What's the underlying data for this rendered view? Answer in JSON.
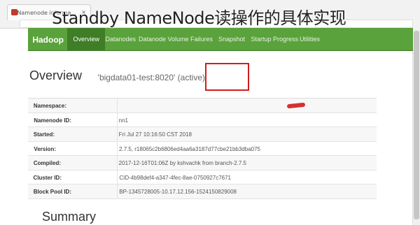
{
  "caption": "Standby NameNode读操作的具体实现",
  "browser": {
    "tab_title": "Namenode informa...",
    "tab_close": "×"
  },
  "nav": {
    "brand": "Hadoop",
    "items": [
      "Overview",
      "Datanodes",
      "Datanode Volume Failures",
      "Snapshot",
      "Startup Progress",
      "Utilities"
    ]
  },
  "overview": {
    "title": "Overview",
    "subtitle": "'bigdata01-test:8020' (active)"
  },
  "table": [
    {
      "label": "Namespace:",
      "value": ""
    },
    {
      "label": "Namenode ID:",
      "value": "nn1"
    },
    {
      "label": "Started:",
      "value": "Fri Jul 27 10:16:50 CST 2018"
    },
    {
      "label": "Version:",
      "value": "2.7.5, r18065c2b6806ed4aa6a3187d77cbe21bb3dba075"
    },
    {
      "label": "Compiled:",
      "value": "2017-12-16T01:06Z by kshvachk from branch-2.7.5"
    },
    {
      "label": "Cluster ID:",
      "value": "CID-4b98def4-a347-4fec-8ae-0750927c7671"
    },
    {
      "label": "Block Pool ID:",
      "value": "BP-1345728005-10.17.12.156-1524150829008"
    }
  ],
  "summary_title": "Summary",
  "colors": {
    "nav_green": "#5aa23c",
    "nav_active": "#3f7d27",
    "highlight": "#d11d1d"
  }
}
